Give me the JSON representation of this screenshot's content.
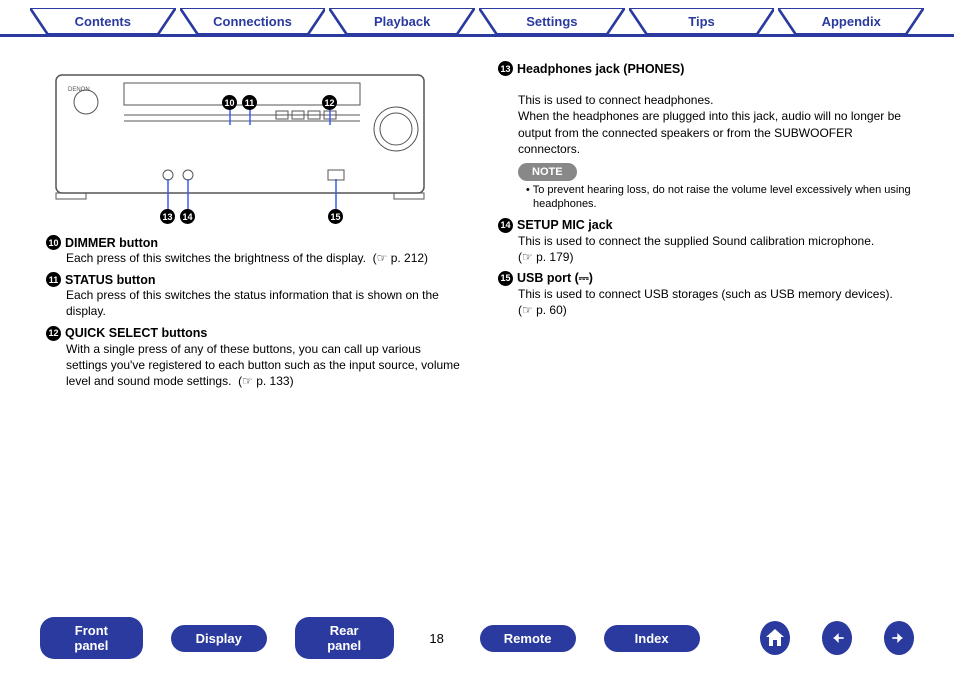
{
  "top_tabs": {
    "contents": "Contents",
    "connections": "Connections",
    "playback": "Playback",
    "settings": "Settings",
    "tips": "Tips",
    "appendix": "Appendix"
  },
  "device": {
    "brand": "DENON",
    "callouts": {
      "c10": "10",
      "c11": "11",
      "c12": "12",
      "c13": "13",
      "c14": "14",
      "c15": "15"
    }
  },
  "left_items": [
    {
      "num": "10",
      "title": "DIMMER button",
      "body": "Each press of this switches the brightness of the display.",
      "ref": "(☞ p. 212)"
    },
    {
      "num": "11",
      "title": "STATUS button",
      "body": "Each press of this switches the status information that is shown on the display.",
      "ref": ""
    },
    {
      "num": "12",
      "title": "QUICK SELECT buttons",
      "body": "With a single press of any of these buttons, you can call up various settings you've registered to each button such as the input source, volume level and sound mode settings.",
      "ref": "(☞ p. 133)"
    }
  ],
  "right_items": [
    {
      "num": "13",
      "title": "Headphones jack (PHONES)",
      "body": "This is used to connect headphones.\nWhen the headphones are plugged into this jack, audio will no longer be output from the connected speakers or from the SUBWOOFER connectors.",
      "ref": "",
      "note": "To prevent hearing loss, do not raise the volume level excessively when using headphones."
    },
    {
      "num": "14",
      "title": "SETUP MIC jack",
      "body": "This is used to connect the supplied Sound calibration microphone.",
      "ref": "(☞ p. 179)"
    },
    {
      "num": "15",
      "title": "USB port (⎓)",
      "body": "This is used to connect USB storages (such as USB memory devices).",
      "ref": "(☞ p. 60)"
    }
  ],
  "note_label": "NOTE",
  "bottom_nav": {
    "front_panel": "Front panel",
    "display": "Display",
    "rear_panel": "Rear panel",
    "remote": "Remote",
    "index": "Index",
    "page_number": "18"
  }
}
